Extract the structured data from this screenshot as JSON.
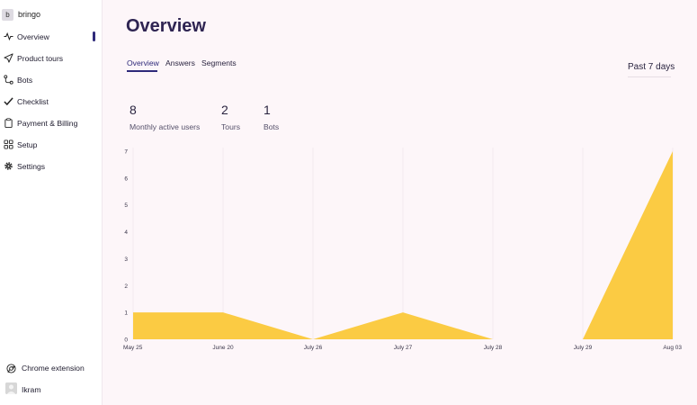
{
  "workspace": {
    "badge": "b",
    "name": "bringo"
  },
  "sidebar": {
    "items": [
      {
        "label": "Overview",
        "icon": "activity-icon",
        "active": true
      },
      {
        "label": "Product tours",
        "icon": "send-icon"
      },
      {
        "label": "Bots",
        "icon": "route-icon"
      },
      {
        "label": "Checklist",
        "icon": "check-icon"
      },
      {
        "label": "Payment & Billing",
        "icon": "clipboard-icon"
      },
      {
        "label": "Setup",
        "icon": "grid-icon"
      },
      {
        "label": "Settings",
        "icon": "gear-icon"
      }
    ],
    "chrome_extension": "Chrome extension",
    "user_name": "Ikram"
  },
  "page_title": "Overview",
  "tabs": [
    {
      "label": "Overview",
      "active": true
    },
    {
      "label": "Answers"
    },
    {
      "label": "Segments"
    }
  ],
  "period_selector": "Past 7 days",
  "stats": [
    {
      "value": "8",
      "label": "Monthly active users"
    },
    {
      "value": "2",
      "label": "Tours"
    },
    {
      "value": "1",
      "label": "Bots"
    }
  ],
  "colors": {
    "accent": "#2e2a7a",
    "area_fill": "#fbcb43",
    "background": "#fdf6f9"
  },
  "chart_data": {
    "type": "area",
    "categories": [
      "May 25",
      "June 20",
      "July 26",
      "July 27",
      "July 28",
      "July 29",
      "Aug 03"
    ],
    "series": [
      {
        "values": [
          1,
          1,
          0,
          1,
          0,
          0,
          7
        ]
      }
    ],
    "ylim": [
      0,
      7
    ],
    "yticks": [
      0,
      1,
      2,
      3,
      4,
      5,
      6,
      7
    ],
    "grid": "vertical"
  }
}
